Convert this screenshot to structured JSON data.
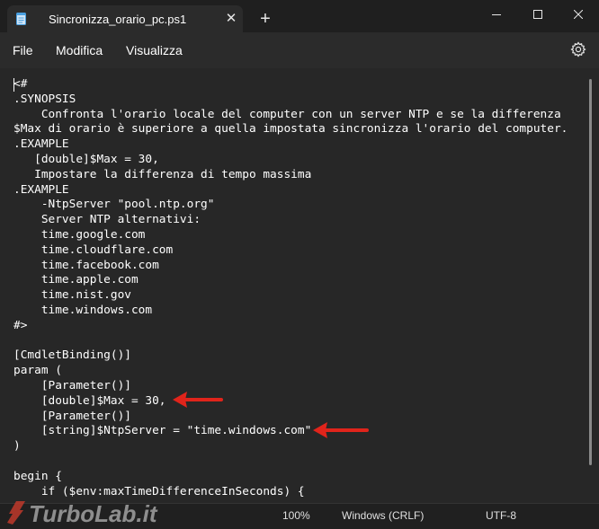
{
  "tab": {
    "title": "Sincronizza_orario_pc.ps1",
    "close_glyph": "✕",
    "icon": "notepad-icon"
  },
  "new_tab_glyph": "+",
  "window_controls": {
    "minimize": "minimize-icon",
    "maximize": "maximize-icon",
    "close": "close-icon"
  },
  "menu": {
    "items": [
      "File",
      "Modifica",
      "Visualizza"
    ],
    "settings_icon": "gear-icon"
  },
  "code_lines": [
    "<#",
    ".SYNOPSIS",
    "    Confronta l'orario locale del computer con un server NTP e se la differenza",
    "$Max di orario è superiore a quella impostata sincronizza l'orario del computer.",
    ".EXAMPLE",
    "   [double]$Max = 30,",
    "   Impostare la differenza di tempo massima",
    ".EXAMPLE",
    "    -NtpServer \"pool.ntp.org\"",
    "    Server NTP alternativi:",
    "    time.google.com",
    "    time.cloudflare.com",
    "    time.facebook.com",
    "    time.apple.com",
    "    time.nist.gov",
    "    time.windows.com",
    "#>",
    "",
    "[CmdletBinding()]",
    "param (",
    "    [Parameter()]",
    "    [double]$Max = 30,",
    "    [Parameter()]",
    "    [string]$NtpServer = \"time.windows.com\"",
    ")",
    "",
    "begin {",
    "    if ($env:maxTimeDifferenceInSeconds) {"
  ],
  "annotations": {
    "arrow_color": "#e0241b"
  },
  "status": {
    "zoom": "100%",
    "line_ending": "Windows (CRLF)",
    "encoding": "UTF-8"
  },
  "watermark": {
    "text": "TurboLab.it"
  }
}
